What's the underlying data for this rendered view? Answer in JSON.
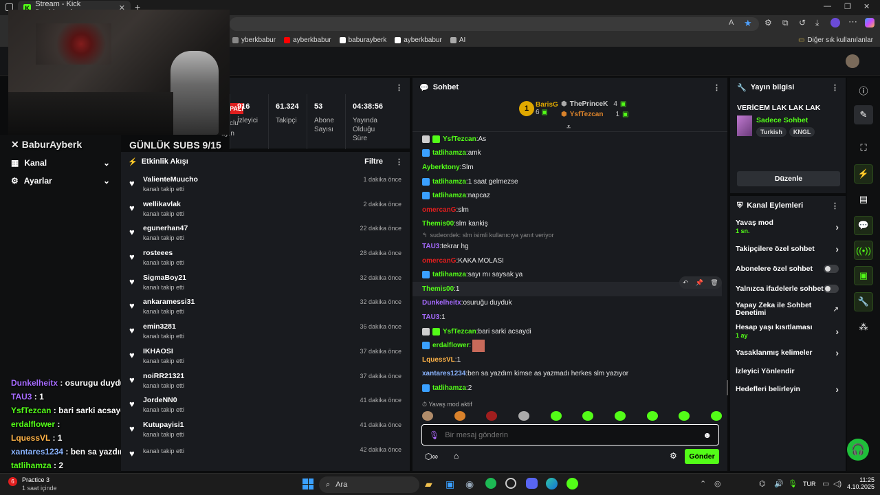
{
  "browser": {
    "tab_title": "Stream - Kick Dashboard",
    "bookmarks": [
      {
        "label": "yberkbabur",
        "color": "#888"
      },
      {
        "label": "ayberkbabur",
        "color": "#ff0000"
      },
      {
        "label": "baburayberk",
        "color": "#ffffff"
      },
      {
        "label": "ayberkbabur",
        "color": "#ffffff"
      },
      {
        "label": "AI",
        "color": "#aaaaaa"
      }
    ],
    "other_bookmarks": "Diğer sık kullanılanlar"
  },
  "stream_overlay": {
    "handle": "BaburAyberk",
    "subs_goal": "GÜNLÜK SUBS 9/15",
    "chat": [
      {
        "user": "Dunkelheitx",
        "msg": " : osurugu duyduk",
        "color": "#a66bff"
      },
      {
        "user": "TAU3",
        "msg": " : 1",
        "color": "#a66bff"
      },
      {
        "user": "YsfTezcan",
        "msg": " : bari sarki acsaydi",
        "color": "#53fc18"
      },
      {
        "user": "erdalflower",
        "msg": " : ",
        "color": "#53fc18"
      },
      {
        "user": "LquessVL",
        "msg": " : 1",
        "color": "#ffb347"
      },
      {
        "user": "xantares1234",
        "msg": " : ben sa yazdım kimse as yazmadı herkes slm yazıyor",
        "color": "#8ab4ff"
      },
      {
        "user": "tatlihamza",
        "msg": " : 2",
        "color": "#53fc18"
      }
    ]
  },
  "nav": {
    "kanal": "Kanal",
    "ayarlar": "Ayarlar"
  },
  "status": {
    "label": "PALI",
    "partial_left": [
      "Gelir",
      "clu",
      "ayın"
    ]
  },
  "stats": [
    {
      "value": "916",
      "label": "İzleyici"
    },
    {
      "value": "61.324",
      "label": "Takipçi"
    },
    {
      "value": "53",
      "label": "Abone Sayısı"
    },
    {
      "value": "04:38:56",
      "label": "Yayında Olduğu Süre"
    }
  ],
  "activity": {
    "title": "Etkinlik Akışı",
    "filter": "Filtre",
    "items": [
      {
        "name": "ValienteMuucho",
        "sub": "kanalı takip etti",
        "time": "1 dakika önce"
      },
      {
        "name": "wellikavlak",
        "sub": "kanalı takip etti",
        "time": "2 dakika önce"
      },
      {
        "name": "egunerhan47",
        "sub": "kanalı takip etti",
        "time": "22 dakika önce"
      },
      {
        "name": "rosteees",
        "sub": "kanalı takip etti",
        "time": "28 dakika önce"
      },
      {
        "name": "SigmaBoy21",
        "sub": "kanalı takip etti",
        "time": "32 dakika önce"
      },
      {
        "name": "ankaramessi31",
        "sub": "kanalı takip etti",
        "time": "32 dakika önce"
      },
      {
        "name": "emin3281",
        "sub": "kanalı takip etti",
        "time": "36 dakika önce"
      },
      {
        "name": "IKHAOSI",
        "sub": "kanalı takip etti",
        "time": "37 dakika önce"
      },
      {
        "name": "noiRR21321",
        "sub": "kanalı takip etti",
        "time": "37 dakika önce"
      },
      {
        "name": "JordeNN0",
        "sub": "kanalı takip etti",
        "time": "41 dakika önce"
      },
      {
        "name": "Kutupayisi1",
        "sub": "kanalı takip etti",
        "time": "41 dakika önce"
      },
      {
        "name": "",
        "sub": "kanalı takip etti",
        "time": "42 dakika önce"
      }
    ]
  },
  "chat": {
    "title": "Sohbet",
    "leaderboard": {
      "first": {
        "name": "BarisG",
        "count": "6"
      },
      "second": {
        "name": "ThePrinceK",
        "count": "4"
      },
      "third": {
        "name": "YsfTezcan",
        "count": "1"
      }
    },
    "messages": [
      {
        "user": "YsfTezcan",
        "text": "As",
        "color": "#53fc18",
        "badges": [
          "#cfcfcf",
          "#53fc18"
        ]
      },
      {
        "user": "tatlihamza",
        "text": "amk",
        "color": "#53fc18",
        "badges": [
          "#3aa0ff"
        ]
      },
      {
        "user": "Ayberktony",
        "text": "Slm",
        "color": "#53fc18",
        "badges": []
      },
      {
        "user": "tatlihamza",
        "text": "1 saat gelmezse",
        "color": "#53fc18",
        "badges": [
          "#3aa0ff"
        ]
      },
      {
        "user": "tatlihamza",
        "text": "napcaz",
        "color": "#53fc18",
        "badges": [
          "#3aa0ff"
        ]
      },
      {
        "user": "omercanG",
        "text": "slm",
        "color": "#e01e1e",
        "badges": []
      },
      {
        "user": "Themis00",
        "text": "slm kankiş",
        "color": "#53fc18",
        "badges": []
      },
      {
        "reply": "sudeordek: slm isimli kullanıcıya yanıt veriyor"
      },
      {
        "user": "TAU3",
        "text": "tekrar hg",
        "color": "#a66bff",
        "badges": []
      },
      {
        "user": "omercanG",
        "text": "KAKA MOLASI",
        "color": "#e01e1e",
        "badges": []
      },
      {
        "user": "tatlihamza",
        "text": "sayı mı saysak ya",
        "color": "#53fc18",
        "badges": [
          "#3aa0ff"
        ]
      },
      {
        "user": "Themis00",
        "text": "1",
        "color": "#53fc18",
        "badges": [],
        "hover": true
      },
      {
        "user": "Dunkelheitx",
        "text": "osuruğu duyduk",
        "color": "#a66bff",
        "badges": []
      },
      {
        "user": "TAU3",
        "text": "1",
        "color": "#a66bff",
        "badges": []
      },
      {
        "user": "YsfTezcan",
        "text": "bari sarki acsaydi",
        "color": "#53fc18",
        "badges": [
          "#cfcfcf",
          "#53fc18"
        ]
      },
      {
        "user": "erdalflower",
        "text": "",
        "color": "#53fc18",
        "badges": [
          "#3aa0ff"
        ]
      },
      {
        "user": "LquessVL",
        "text": "1",
        "color": "#ffb347",
        "badges": []
      },
      {
        "user": "xantares1234",
        "text": "ben sa yazdım kimse as yazmadı herkes slm yazıyor",
        "color": "#8ab4ff",
        "badges": []
      },
      {
        "user": "tatlihamza",
        "text": "2",
        "color": "#53fc18",
        "badges": [
          "#3aa0ff"
        ]
      }
    ],
    "slow_mode": "Yavaş mod aktif",
    "placeholder": "Bir mesaj gönderin",
    "send": "Gönder"
  },
  "stream_info": {
    "title": "Yayın bilgisi",
    "stream_title": "VERİCEM LAK LAK LAK",
    "category": "Sadece Sohbet",
    "tags": [
      "Turkish",
      "KNGL"
    ],
    "edit": "Düzenle"
  },
  "channel_actions": {
    "title": "Kanal Eylemleri",
    "items": [
      {
        "label": "Yavaş mod",
        "sub": "1 sn.",
        "type": "chevron"
      },
      {
        "label": "Takipçilere özel sohbet",
        "sub": "",
        "type": "chevron"
      },
      {
        "label": "Abonelere özel sohbet",
        "sub": "",
        "type": "toggle"
      },
      {
        "label": "Yalnızca ifadelerle sohbet",
        "sub": "",
        "type": "toggle"
      },
      {
        "label": "Yapay Zeka ile Sohbet Denetimi",
        "sub": "",
        "type": "external"
      },
      {
        "label": "Hesap yaşı kısıtlaması",
        "sub": "1 ay",
        "type": "chevron"
      },
      {
        "label": "Yasaklanmış kelimeler",
        "sub": "",
        "type": "chevron"
      },
      {
        "label": "İzleyici Yönlendir",
        "sub": "",
        "type": "none"
      },
      {
        "label": "Hedefleri belirleyin",
        "sub": "",
        "type": "chevron"
      }
    ]
  },
  "taskbar": {
    "notif_title": "Practice 3",
    "notif_sub": "1 saat içinde",
    "notif_badge": "6",
    "search": "Ara",
    "lang": "TUR",
    "time": "11:25",
    "date": "4.10.2025"
  },
  "colors": {
    "accent": "#53fc18",
    "panel": "#191b1f",
    "bg": "#0b0c0d"
  }
}
